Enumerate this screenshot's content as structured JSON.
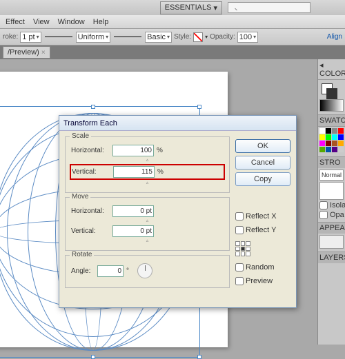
{
  "appbar": {
    "essentials": "ESSENTIALS",
    "tri": "▾"
  },
  "menu": [
    "Effect",
    "View",
    "Window",
    "Help"
  ],
  "props": {
    "stroke": "roke:",
    "stroke_val": "1 pt",
    "uniform": "Uniform",
    "basic": "Basic",
    "style": "Style:",
    "opacity": "Opacity:",
    "opacity_val": "100",
    "align": "Align"
  },
  "tab": {
    "label": "/Preview)"
  },
  "dialog": {
    "title": "Transform Each",
    "scale": "Scale",
    "horizontal": "Horizontal:",
    "vertical": "Vertical:",
    "scale_h": "100",
    "scale_v": "115",
    "pct": "%",
    "move": "Move",
    "move_h": "0 pt",
    "move_v": "0 pt",
    "rotate": "Rotate",
    "angle": "Angle:",
    "angle_val": "0",
    "deg": "°",
    "ok": "OK",
    "cancel": "Cancel",
    "copy": "Copy",
    "reflectx": "Reflect X",
    "reflecty": "Reflect Y",
    "random": "Random",
    "preview": "Preview"
  },
  "side": {
    "color": "COLOR",
    "swat": "SWATC",
    "stro": "STRO",
    "normal": "Normal",
    "isola": "Isola",
    "opa": "Opa",
    "appe": "APPEAR",
    "layers": "LAYERS"
  }
}
